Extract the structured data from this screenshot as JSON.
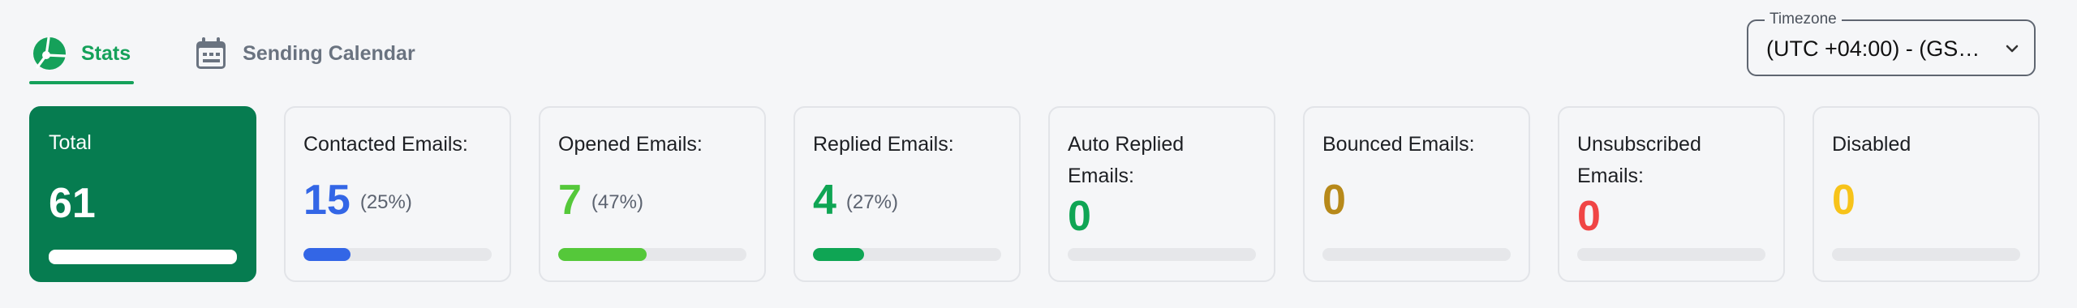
{
  "tabs": [
    {
      "label": "Stats",
      "icon": "pie-chart-icon",
      "active": true
    },
    {
      "label": "Sending Calendar",
      "icon": "calendar-icon",
      "active": false
    }
  ],
  "timezone": {
    "legend": "Timezone",
    "value": "(UTC +04:00) - (GS…"
  },
  "cards": [
    {
      "title": "Total",
      "value": "61",
      "percent": "",
      "progress": 1.0,
      "color": "#ffffff"
    },
    {
      "title": "Contacted Emails:",
      "value": "15",
      "percent": "(25%)",
      "progress": 0.25,
      "color": "#3366e6"
    },
    {
      "title": "Opened Emails:",
      "value": "7",
      "percent": "(47%)",
      "progress": 0.47,
      "color": "#55c83a"
    },
    {
      "title": "Replied Emails:",
      "value": "4",
      "percent": "(27%)",
      "progress": 0.27,
      "color": "#0fa554"
    },
    {
      "title": "Auto Replied Emails:",
      "value": "0",
      "percent": "",
      "progress": 0,
      "color": "#0fa554"
    },
    {
      "title": "Bounced Emails:",
      "value": "0",
      "percent": "",
      "progress": 0,
      "color": "#b7891a"
    },
    {
      "title": "Unsubscribed Emails:",
      "value": "0",
      "percent": "",
      "progress": 0,
      "color": "#f04545"
    },
    {
      "title": "Disabled",
      "value": "0",
      "percent": "",
      "progress": 0,
      "color": "#f7c31a"
    }
  ]
}
